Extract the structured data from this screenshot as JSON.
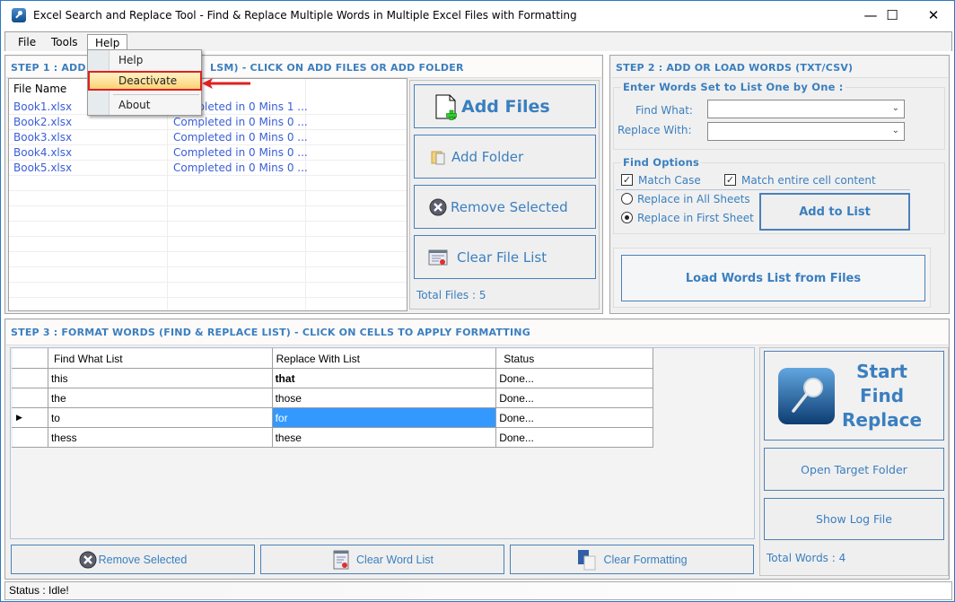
{
  "window": {
    "title": "Excel Search and Replace Tool - Find & Replace Multiple Words in Multiple Excel Files with Formatting",
    "icon": "app-magnifier-icon",
    "controls": {
      "minimize": "—",
      "maximize": "☐",
      "close": "✕"
    }
  },
  "menu": {
    "items": [
      {
        "label": "File"
      },
      {
        "label": "Tools"
      },
      {
        "label": "Help"
      }
    ],
    "open_menu": "Help",
    "dropdown": [
      {
        "label": "Help"
      },
      {
        "label": "Deactivate",
        "highlighted": true
      },
      {
        "label": "About"
      }
    ]
  },
  "step1": {
    "title_left": "STEP 1 : ADD",
    "title_right": "LSM) - CLICK ON ADD FILES OR ADD FOLDER",
    "columns": [
      "File Name",
      ""
    ],
    "files": [
      {
        "name": "Book1.xlsx",
        "status": "Completed in 0 Mins 1 ..."
      },
      {
        "name": "Book2.xlsx",
        "status": "Completed in 0 Mins 0 ..."
      },
      {
        "name": "Book3.xlsx",
        "status": "Completed in 0 Mins 0 ..."
      },
      {
        "name": "Book4.xlsx",
        "status": "Completed in 0 Mins 0 ..."
      },
      {
        "name": "Book5.xlsx",
        "status": "Completed in 0 Mins 0 ..."
      }
    ],
    "buttons": {
      "add_files": "Add Files",
      "add_folder": "Add Folder",
      "remove_selected": "Remove Selected",
      "clear_file_list": "Clear File List"
    },
    "total_files": "Total Files : 5"
  },
  "step2": {
    "title": "STEP 2 : ADD OR LOAD WORDS (TXT/CSV)",
    "group_title": "Enter Words Set to List One by One :",
    "find_what_label": "Find What:",
    "find_what_value": "",
    "replace_with_label": "Replace With:",
    "replace_with_value": "",
    "options_title": "Find Options",
    "match_case": {
      "label": "Match Case",
      "checked": true
    },
    "match_entire": {
      "label": "Match entire cell content",
      "checked": true
    },
    "replace_all_sheets": {
      "label": "Replace in All Sheets",
      "selected": false
    },
    "replace_first_sheet": {
      "label": "Replace in First Sheet",
      "selected": true
    },
    "add_to_list": "Add to List",
    "load_words": "Load Words List from Files"
  },
  "step3": {
    "title": "STEP 3 : FORMAT WORDS (FIND & REPLACE LIST) - CLICK ON CELLS TO APPLY FORMATTING",
    "columns": [
      "Find What List",
      "Replace With List",
      "Status"
    ],
    "rows": [
      {
        "find": "this",
        "replace": "that",
        "status": "Done...",
        "replace_bold": true
      },
      {
        "find": "the",
        "replace": "those",
        "status": "Done..."
      },
      {
        "find": "to",
        "replace": "for",
        "status": "Done...",
        "selected": true
      },
      {
        "find": "thess",
        "replace": "these",
        "status": "Done..."
      }
    ],
    "buttons": {
      "remove_selected": "Remove Selected",
      "clear_word_list": "Clear Word List",
      "clear_formatting": "Clear Formatting"
    },
    "start": [
      "Start",
      "Find",
      "Replace"
    ],
    "open_target_folder": "Open Target Folder",
    "show_log_file": "Show Log File",
    "total_words": "Total Words : 4"
  },
  "status": {
    "text": "Status  :  Idle!"
  },
  "colors": {
    "accent": "#3a7fbf",
    "selection": "#3399ff",
    "highlight_border": "#e02020"
  }
}
